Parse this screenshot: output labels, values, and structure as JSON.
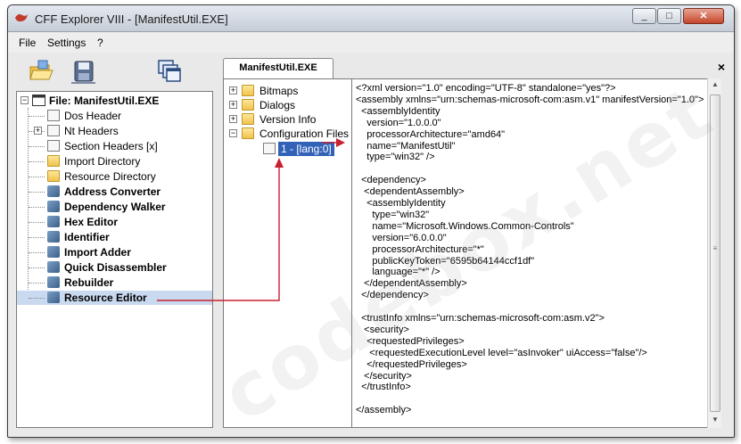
{
  "window": {
    "title": "CFF Explorer VIII - [ManifestUtil.EXE]",
    "min_label": "_",
    "max_label": "□",
    "close_label": "✕"
  },
  "menu": {
    "file": "File",
    "settings": "Settings",
    "help": "?"
  },
  "toolbar": {
    "icons": [
      "open-folder-icon",
      "save-icon",
      "windows-icon"
    ]
  },
  "tree": {
    "root": "File: ManifestUtil.EXE",
    "items": [
      {
        "label": "Dos Header",
        "icon": "page-icon",
        "bold": false
      },
      {
        "label": "Nt Headers",
        "icon": "page-icon",
        "bold": false,
        "expandable": true
      },
      {
        "label": "Section Headers [x]",
        "icon": "page-icon",
        "bold": false
      },
      {
        "label": "Import Directory",
        "icon": "folder-icon",
        "bold": false
      },
      {
        "label": "Resource Directory",
        "icon": "folder-icon",
        "bold": false
      },
      {
        "label": "Address Converter",
        "icon": "tool-icon",
        "bold": true
      },
      {
        "label": "Dependency Walker",
        "icon": "tool-icon",
        "bold": true
      },
      {
        "label": "Hex Editor",
        "icon": "tool-icon",
        "bold": true
      },
      {
        "label": "Identifier",
        "icon": "tool-icon",
        "bold": true
      },
      {
        "label": "Import Adder",
        "icon": "tool-icon",
        "bold": true
      },
      {
        "label": "Quick Disassembler",
        "icon": "tool-icon",
        "bold": true
      },
      {
        "label": "Rebuilder",
        "icon": "tool-icon",
        "bold": true
      },
      {
        "label": "Resource Editor",
        "icon": "tool-icon",
        "bold": true,
        "selected": true
      }
    ]
  },
  "tab": {
    "label": "ManifestUtil.EXE",
    "close": "×"
  },
  "resources": {
    "nodes": [
      "Bitmaps",
      "Dialogs",
      "Version Info",
      "Configuration Files"
    ],
    "selected_child": "1 - [lang:0]"
  },
  "xml": {
    "lines": [
      "<?xml version=\"1.0\" encoding=\"UTF-8\" standalone=\"yes\"?>",
      "<assembly xmlns=\"urn:schemas-microsoft-com:asm.v1\" manifestVersion=\"1.0\">",
      "  <assemblyIdentity",
      "    version=\"1.0.0.0\"",
      "    processorArchitecture=\"amd64\"",
      "    name=\"ManifestUtil\"",
      "    type=\"win32\" />",
      "",
      "  <dependency>",
      "   <dependentAssembly>",
      "    <assemblyIdentity",
      "      type=\"win32\"",
      "      name=\"Microsoft.Windows.Common-Controls\"",
      "      version=\"6.0.0.0\"",
      "      processorArchitecture=\"*\"",
      "      publicKeyToken=\"6595b64144ccf1df\"",
      "      language=\"*\" />",
      "   </dependentAssembly>",
      "  </dependency>",
      "",
      "  <trustInfo xmlns=\"urn:schemas-microsoft-com:asm.v2\">",
      "   <security>",
      "    <requestedPrivileges>",
      "     <requestedExecutionLevel level=\"asInvoker\" uiAccess=\"false\"/>",
      "    </requestedPrivileges>",
      "   </security>",
      "  </trustInfo>",
      "",
      "</assembly>"
    ]
  },
  "watermark": "codebox.net",
  "colors": {
    "selection": "#3162b8",
    "arrow": "#c8202f",
    "tree_selected": "#c9d9ef"
  }
}
